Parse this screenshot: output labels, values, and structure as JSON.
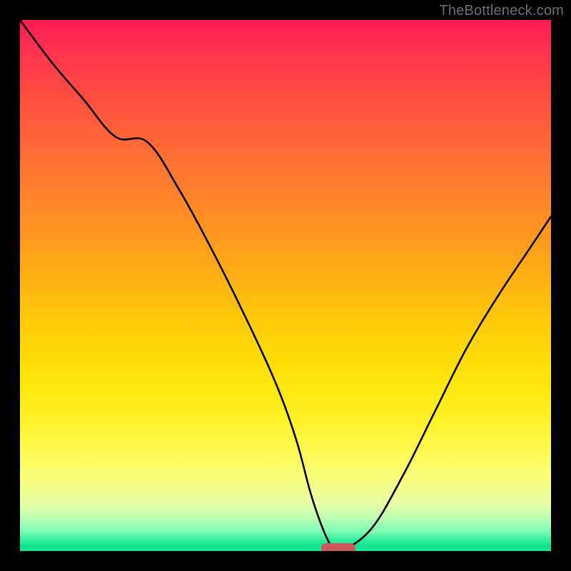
{
  "watermark": "TheBottleneck.com",
  "colors": {
    "frame": "#000000",
    "curve": "#000000",
    "marker": "#cd5a5b"
  },
  "chart_data": {
    "type": "line",
    "title": "",
    "xlabel": "",
    "ylabel": "",
    "xlim": [
      0,
      100
    ],
    "ylim": [
      0,
      100
    ],
    "grid": false,
    "series": [
      {
        "name": "bottleneck-curve",
        "x": [
          0,
          6,
          12,
          18,
          24,
          30,
          36,
          42,
          48,
          52,
          55,
          58,
          60,
          66,
          72,
          78,
          84,
          90,
          96,
          100
        ],
        "values": [
          100,
          92,
          85,
          78,
          77,
          68,
          57,
          45,
          32,
          21,
          10,
          2,
          0,
          4,
          14,
          26,
          38,
          48,
          57,
          63
        ]
      }
    ],
    "marker": {
      "x": 60,
      "y": 0,
      "width_pct": 6.4
    }
  }
}
